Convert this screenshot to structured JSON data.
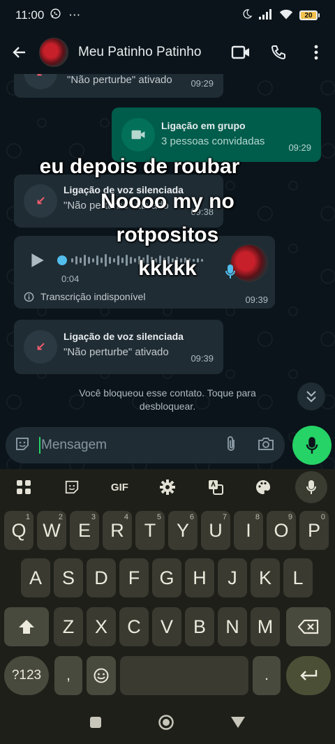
{
  "status": {
    "time": "11:00",
    "battery": "20"
  },
  "header": {
    "name": "Meu Patinho Patinho"
  },
  "messages": {
    "m0": {
      "subtitle": "\"Não perturbe\" ativado",
      "time": "09:29"
    },
    "m1": {
      "title": "Ligação em grupo",
      "subtitle": "3 pessoas convidadas",
      "time": "09:29"
    },
    "m2": {
      "title": "Ligação de voz silenciada",
      "subtitle": "\"Não perturbe\" ativado",
      "time": "09:38"
    },
    "m3": {
      "duration": "0:04",
      "transcription": "Transcrição indisponível",
      "time": "09:39"
    },
    "m4": {
      "title": "Ligação de voz silenciada",
      "subtitle": "\"Não perturbe\" ativado",
      "time": "09:39"
    }
  },
  "meme": {
    "line1": "eu depois de roubar",
    "line2": "Noooo my no",
    "line3": "rotpositos",
    "line4": "kkkkk"
  },
  "notice": "Você bloqueou esse contato. Toque para desbloquear.",
  "input": {
    "placeholder": "Mensagem"
  },
  "keyboard": {
    "gif": "GIF",
    "row1": [
      {
        "k": "Q",
        "n": "1"
      },
      {
        "k": "W",
        "n": "2"
      },
      {
        "k": "E",
        "n": "3"
      },
      {
        "k": "R",
        "n": "4"
      },
      {
        "k": "T",
        "n": "5"
      },
      {
        "k": "Y",
        "n": "6"
      },
      {
        "k": "U",
        "n": "7"
      },
      {
        "k": "I",
        "n": "8"
      },
      {
        "k": "O",
        "n": "9"
      },
      {
        "k": "P",
        "n": "0"
      }
    ],
    "row2": [
      "A",
      "S",
      "D",
      "F",
      "G",
      "H",
      "J",
      "K",
      "L"
    ],
    "row3": [
      "Z",
      "X",
      "C",
      "V",
      "B",
      "N",
      "M"
    ],
    "symbols": "?123",
    "comma": ",",
    "period": "."
  }
}
